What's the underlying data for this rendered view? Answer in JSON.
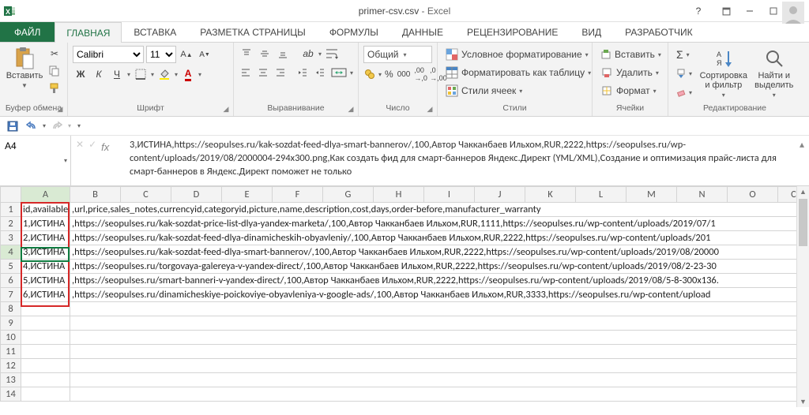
{
  "app": {
    "name": "Excel",
    "filename": "primer-csv.csv"
  },
  "tabs": {
    "file": "ФАЙЛ",
    "list": [
      "ГЛАВНАЯ",
      "ВСТАВКА",
      "РАЗМЕТКА СТРАНИЦЫ",
      "ФОРМУЛЫ",
      "ДАННЫЕ",
      "РЕЦЕНЗИРОВАНИЕ",
      "ВИД",
      "РАЗРАБОТЧИК"
    ],
    "active": 0
  },
  "ribbon": {
    "clipboard": {
      "title": "Буфер обмена",
      "paste": "Вставить"
    },
    "font": {
      "title": "Шрифт",
      "name": "Calibri",
      "size": "11",
      "bold": "Ж",
      "italic": "К",
      "underline": "Ч"
    },
    "alignment": {
      "title": "Выравнивание"
    },
    "number": {
      "title": "Число",
      "format": "Общий"
    },
    "styles": {
      "title": "Стили",
      "cond": "Условное форматирование",
      "table": "Форматировать как таблицу",
      "cell": "Стили ячеек"
    },
    "cells": {
      "title": "Ячейки",
      "insert": "Вставить",
      "delete": "Удалить",
      "format": "Формат"
    },
    "editing": {
      "title": "Редактирование",
      "sum": "Σ",
      "sort": "Сортировка и фильтр",
      "find": "Найти и выделить"
    }
  },
  "namebox": "A4",
  "formula": "3,ИСТИНА,https://seopulses.ru/kak-sozdat-feed-dlya-smart-bannerov/,100,Автор Чакканбаев Ильхом,RUR,2222,https://seopulses.ru/wp-content/uploads/2019/08/2000004-294x300.png,Как создать фид для смарт-баннеров Яндекс.Директ (YML/XML),Создание и оптимизация прайс-листа для смарт-баннеров в Яндекс.Директ поможет не только",
  "columns": [
    "A",
    "B",
    "C",
    "D",
    "E",
    "F",
    "G",
    "H",
    "I",
    "J",
    "K",
    "L",
    "M",
    "N",
    "O",
    "C"
  ],
  "rows": [
    {
      "n": 1,
      "a": "id,available",
      "rest": ",url,price,sales_notes,currencyid,categoryid,picture,name,description,cost,days,order-before,manufacturer_warranty"
    },
    {
      "n": 2,
      "a": "1,ИСТИНА",
      "rest": ",https://seopulses.ru/kak-sozdat-price-list-dlya-yandex-marketa/,100,Автор Чакканбаев Ильхом,RUR,1111,https://seopulses.ru/wp-content/uploads/2019/07/1"
    },
    {
      "n": 3,
      "a": "2,ИСТИНА",
      "rest": ",https://seopulses.ru/kak-sozdat-feed-dlya-dinamicheskih-obyavleniy/,100,Автор Чакканбаев Ильхом,RUR,2222,https://seopulses.ru/wp-content/uploads/201"
    },
    {
      "n": 4,
      "a": "3,ИСТИНА",
      "rest": ",https://seopulses.ru/kak-sozdat-feed-dlya-smart-bannerov/,100,Автор Чакканбаев Ильхом,RUR,2222,https://seopulses.ru/wp-content/uploads/2019/08/20000"
    },
    {
      "n": 5,
      "a": "4,ИСТИНА",
      "rest": ",https://seopulses.ru/torgovaya-galereya-v-yandex-direct/,100,Автор Чакканбаев Ильхом,RUR,2222,https://seopulses.ru/wp-content/uploads/2019/08/2-23-30"
    },
    {
      "n": 6,
      "a": "5,ИСТИНА",
      "rest": ",https://seopulses.ru/smart-banneri-v-yandex-direct/,100,Автор Чакканбаев Ильхом,RUR,2222,https://seopulses.ru/wp-content/uploads/2019/08/5-8-300x136."
    },
    {
      "n": 7,
      "a": "6,ИСТИНА",
      "rest": ",https://seopulses.ru/dinamicheskiye-poickoviye-obyavleniya-v-google-ads/,100,Автор Чакканбаев Ильхом,RUR,3333,https://seopulses.ru/wp-content/upload"
    },
    {
      "n": 8,
      "a": "",
      "rest": ""
    },
    {
      "n": 9,
      "a": "",
      "rest": ""
    },
    {
      "n": 10,
      "a": "",
      "rest": ""
    },
    {
      "n": 11,
      "a": "",
      "rest": ""
    },
    {
      "n": 12,
      "a": "",
      "rest": ""
    },
    {
      "n": 13,
      "a": "",
      "rest": ""
    },
    {
      "n": 14,
      "a": "",
      "rest": ""
    }
  ],
  "colors": {
    "accent": "#217346",
    "sel": "#107c41",
    "highlight": "#d62828"
  }
}
